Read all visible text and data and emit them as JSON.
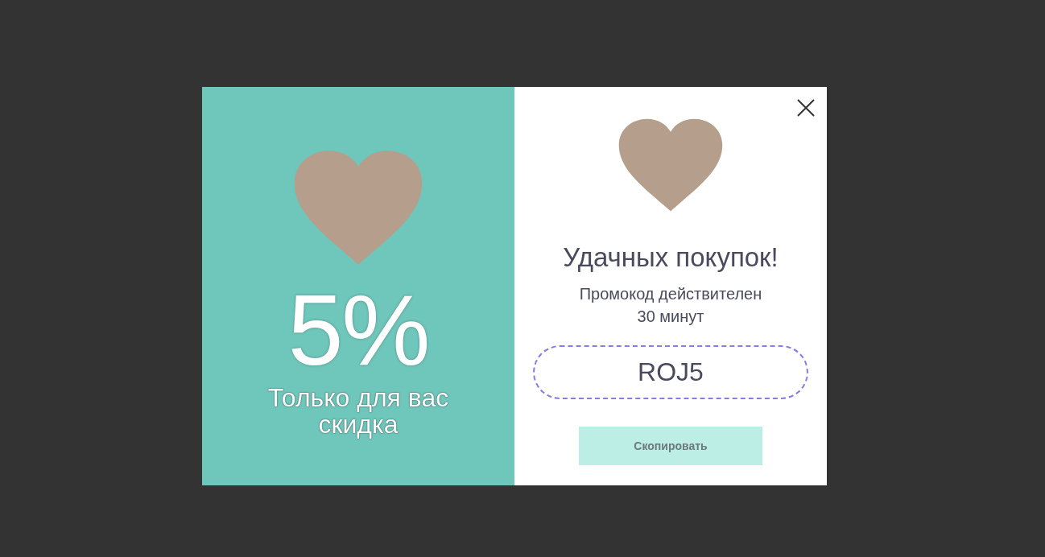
{
  "promo": {
    "discount": {
      "value": "5%",
      "caption": "Только для вас скидка"
    },
    "title": "Удачных покупок!",
    "note": "Промокод действителен 30 минут",
    "code": "ROJ5",
    "button": "Скопировать"
  }
}
